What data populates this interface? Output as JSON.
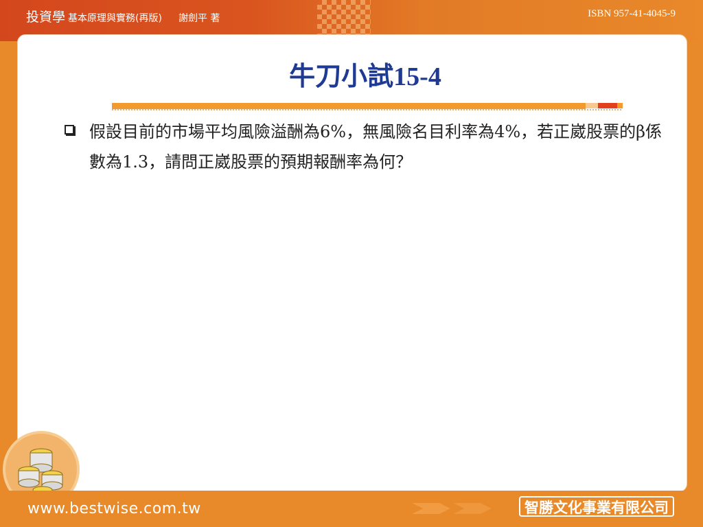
{
  "header": {
    "book_title": "投資學",
    "book_subtitle": "基本原理與實務(再版)",
    "author": "謝劍平 著",
    "isbn": "ISBN 957-41-4045-9"
  },
  "slide": {
    "title_cjk": "牛刀小試",
    "title_num": "15-4",
    "question": "假設目前的市場平均風險溢酬為6%，無風險名目利率為4%，若正崴股票的β係數為1.3，請問正崴股票的預期報酬率為何？"
  },
  "footer": {
    "url": "www.bestwise.com.tw",
    "publisher": "智勝文化事業有限公司"
  },
  "colors": {
    "background": "#e8892a",
    "header_red": "#d4471d",
    "title_blue": "#1f3a93",
    "rule_orange": "#f39a2c",
    "rule_red": "#e2401c"
  },
  "icons": [
    "square-bullet-icon",
    "coins-icon",
    "arrow-right-icon"
  ]
}
